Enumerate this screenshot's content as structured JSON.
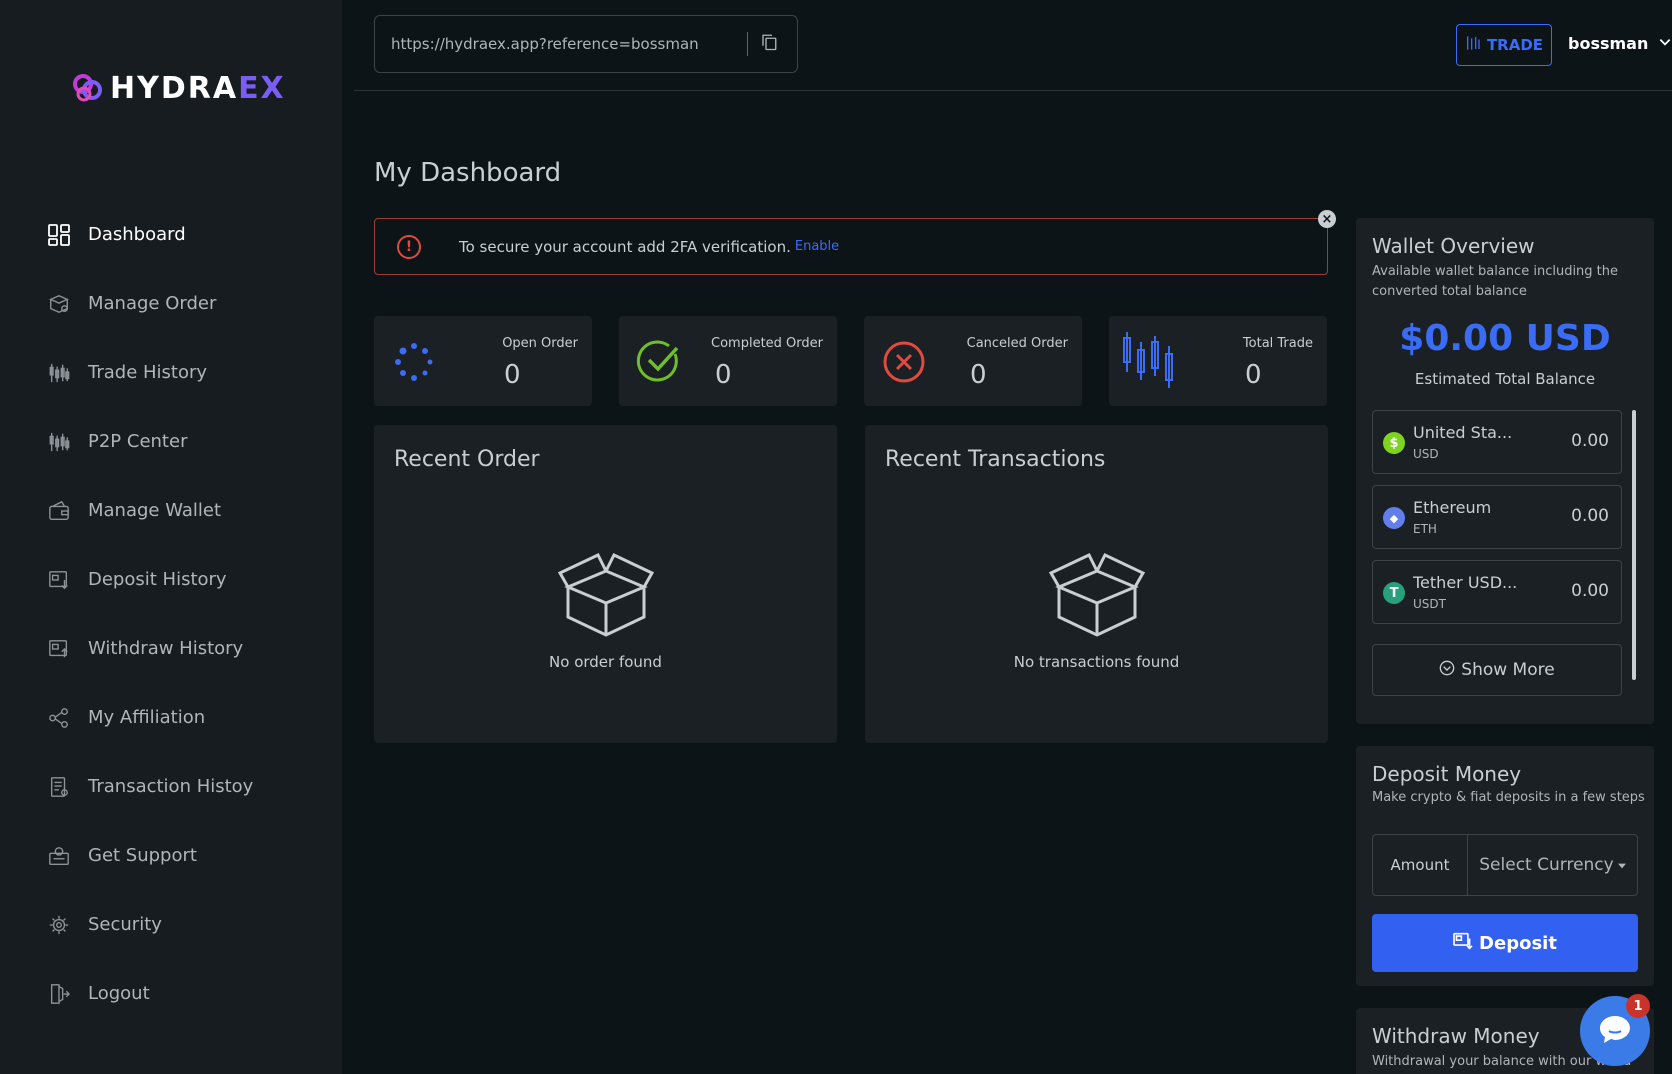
{
  "brand": {
    "name_main": "HYDRA",
    "name_accent": "EX"
  },
  "sidebar": {
    "items": [
      {
        "label": "Dashboard",
        "icon": "dashboard-icon",
        "active": true
      },
      {
        "label": "Manage Order",
        "icon": "box-icon"
      },
      {
        "label": "Trade History",
        "icon": "candlestick-icon"
      },
      {
        "label": "P2P Center",
        "icon": "candlestick-icon"
      },
      {
        "label": "Manage Wallet",
        "icon": "wallet-icon"
      },
      {
        "label": "Deposit History",
        "icon": "deposit-icon"
      },
      {
        "label": "Withdraw History",
        "icon": "withdraw-icon"
      },
      {
        "label": "My Affiliation",
        "icon": "share-icon"
      },
      {
        "label": "Transaction Histoy",
        "icon": "document-icon"
      },
      {
        "label": "Get Support",
        "icon": "support-icon"
      },
      {
        "label": "Security",
        "icon": "security-icon"
      },
      {
        "label": "Logout",
        "icon": "logout-icon"
      }
    ]
  },
  "header": {
    "referral_url": "https://hydraex.app?reference=bossman",
    "trade_label": "TRADE",
    "username": "bossman"
  },
  "main": {
    "title": "My Dashboard",
    "alert": {
      "text": "To secure your account add 2FA verification.",
      "link": "Enable"
    },
    "stats": [
      {
        "label": "Open Order",
        "value": "0",
        "icon": "spinner-icon"
      },
      {
        "label": "Completed Order",
        "value": "0",
        "icon": "check-circle-icon"
      },
      {
        "label": "Canceled Order",
        "value": "0",
        "icon": "x-circle-icon"
      },
      {
        "label": "Total Trade",
        "value": "0",
        "icon": "candlestick-icon"
      }
    ],
    "recent_order": {
      "title": "Recent Order",
      "empty": "No order found"
    },
    "recent_transactions": {
      "title": "Recent Transactions",
      "empty": "No transactions found"
    }
  },
  "wallet": {
    "title": "Wallet Overview",
    "subtitle_1": "Available wallet balance including the",
    "subtitle_2": "converted total balance",
    "balance": "$0.00 USD",
    "balance_label": "Estimated Total Balance",
    "assets": [
      {
        "name": "United Sta...",
        "symbol": "USD",
        "value": "0.00",
        "color": "#7ed321",
        "glyph": "$"
      },
      {
        "name": "Ethereum",
        "symbol": "ETH",
        "value": "0.00",
        "color": "#627eea",
        "glyph": "◆"
      },
      {
        "name": "Tether USD...",
        "symbol": "USDT",
        "value": "0.00",
        "color": "#26a17b",
        "glyph": "T"
      }
    ],
    "show_more": "Show More"
  },
  "deposit": {
    "title": "Deposit Money",
    "subtitle": "Make crypto & fiat deposits in a few steps",
    "amount_label": "Amount",
    "currency_placeholder": "Select Currency",
    "button": "Deposit"
  },
  "withdraw": {
    "title": "Withdraw Money",
    "subtitle": "Withdrawal your balance with our world"
  },
  "chat": {
    "badge": "1"
  },
  "colors": {
    "accent": "#3b6cf5",
    "danger": "#e04a3f",
    "success": "#6fbf2a"
  }
}
